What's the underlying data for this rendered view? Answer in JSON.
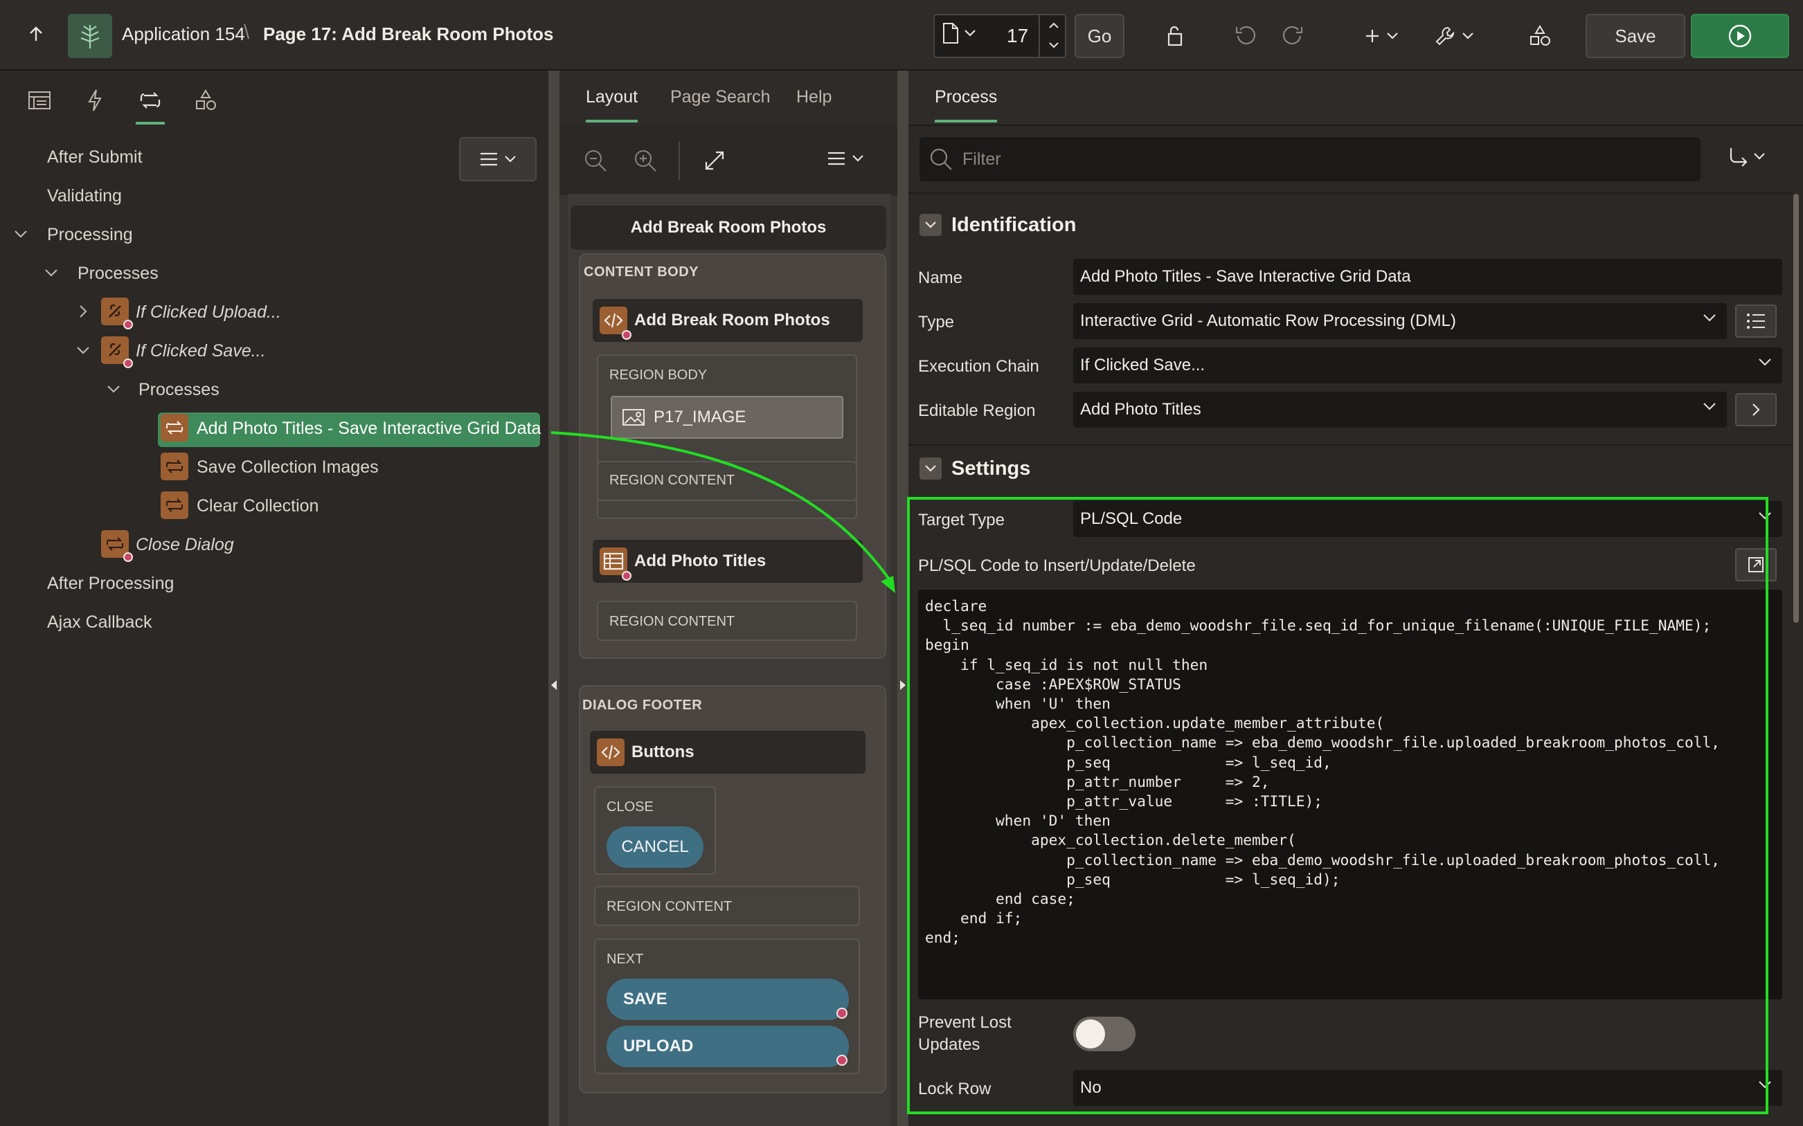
{
  "header": {
    "app_name": "Application 154",
    "crumb_sep": "\\",
    "page_name": "Page 17: Add Break Room Photos",
    "page_number": "17",
    "go_label": "Go",
    "save_label": "Save"
  },
  "left": {
    "tree": {
      "after_submit": "After Submit",
      "validating": "Validating",
      "processing": "Processing",
      "processes": "Processes",
      "if_clicked_upload": "If Clicked Upload...",
      "if_clicked_save": "If Clicked Save...",
      "sub_processes": "Processes",
      "add_photo_titles": "Add Photo Titles - Save Interactive Grid Data",
      "save_collection_images": "Save Collection Images",
      "clear_collection": "Clear Collection",
      "close_dialog": "Close Dialog",
      "after_processing": "After Processing",
      "ajax_callback": "Ajax Callback"
    }
  },
  "middle": {
    "tabs": [
      "Layout",
      "Page Search",
      "Help"
    ],
    "page_title": "Add Break Room Photos",
    "content_body": "CONTENT BODY",
    "region1_title": "Add Break Room Photos",
    "region_body": "REGION BODY",
    "item_p17_image": "P17_IMAGE",
    "region_content_1": "REGION CONTENT",
    "region2_title": "Add Photo Titles",
    "region_content_2": "REGION CONTENT",
    "dialog_footer": "DIALOG FOOTER",
    "buttons_title": "Buttons",
    "close_label": "CLOSE",
    "cancel_button": "CANCEL",
    "region_content_3": "REGION CONTENT",
    "next_label": "NEXT",
    "save_button": "SAVE",
    "upload_button": "UPLOAD"
  },
  "right": {
    "tab": "Process",
    "filter_placeholder": "Filter",
    "identification": "Identification",
    "name_label": "Name",
    "name_value": "Add Photo Titles - Save Interactive Grid Data",
    "type_label": "Type",
    "type_value": "Interactive Grid - Automatic Row Processing (DML)",
    "exec_chain_label": "Execution Chain",
    "exec_chain_value": "If Clicked Save...",
    "editable_region_label": "Editable Region",
    "editable_region_value": "Add Photo Titles",
    "settings": "Settings",
    "target_type_label": "Target Type",
    "target_type_value": "PL/SQL Code",
    "plsql_label": "PL/SQL Code to Insert/Update/Delete",
    "code": "declare\n  l_seq_id number := eba_demo_woodshr_file.seq_id_for_unique_filename(:UNIQUE_FILE_NAME);\nbegin\n    if l_seq_id is not null then\n        case :APEX$ROW_STATUS\n        when 'U' then\n            apex_collection.update_member_attribute(\n                p_collection_name => eba_demo_woodshr_file.uploaded_breakroom_photos_coll,\n                p_seq             => l_seq_id,\n                p_attr_number     => 2,\n                p_attr_value      => :TITLE);\n        when 'D' then\n            apex_collection.delete_member(\n                p_collection_name => eba_demo_woodshr_file.uploaded_breakroom_photos_coll,\n                p_seq             => l_seq_id);\n        end case;\n    end if;\nend;",
    "prevent_lost_label_1": "Prevent Lost",
    "prevent_lost_label_2": "Updates",
    "prevent_lost_value": false,
    "lock_row_label": "Lock Row",
    "lock_row_value": "No"
  },
  "colors": {
    "accent_green": "#3f8a5a",
    "run_green": "#2c7b46",
    "process_icon": "#9c5f32",
    "button_teal": "#3f6f83",
    "annotation_green": "#22dd22"
  }
}
